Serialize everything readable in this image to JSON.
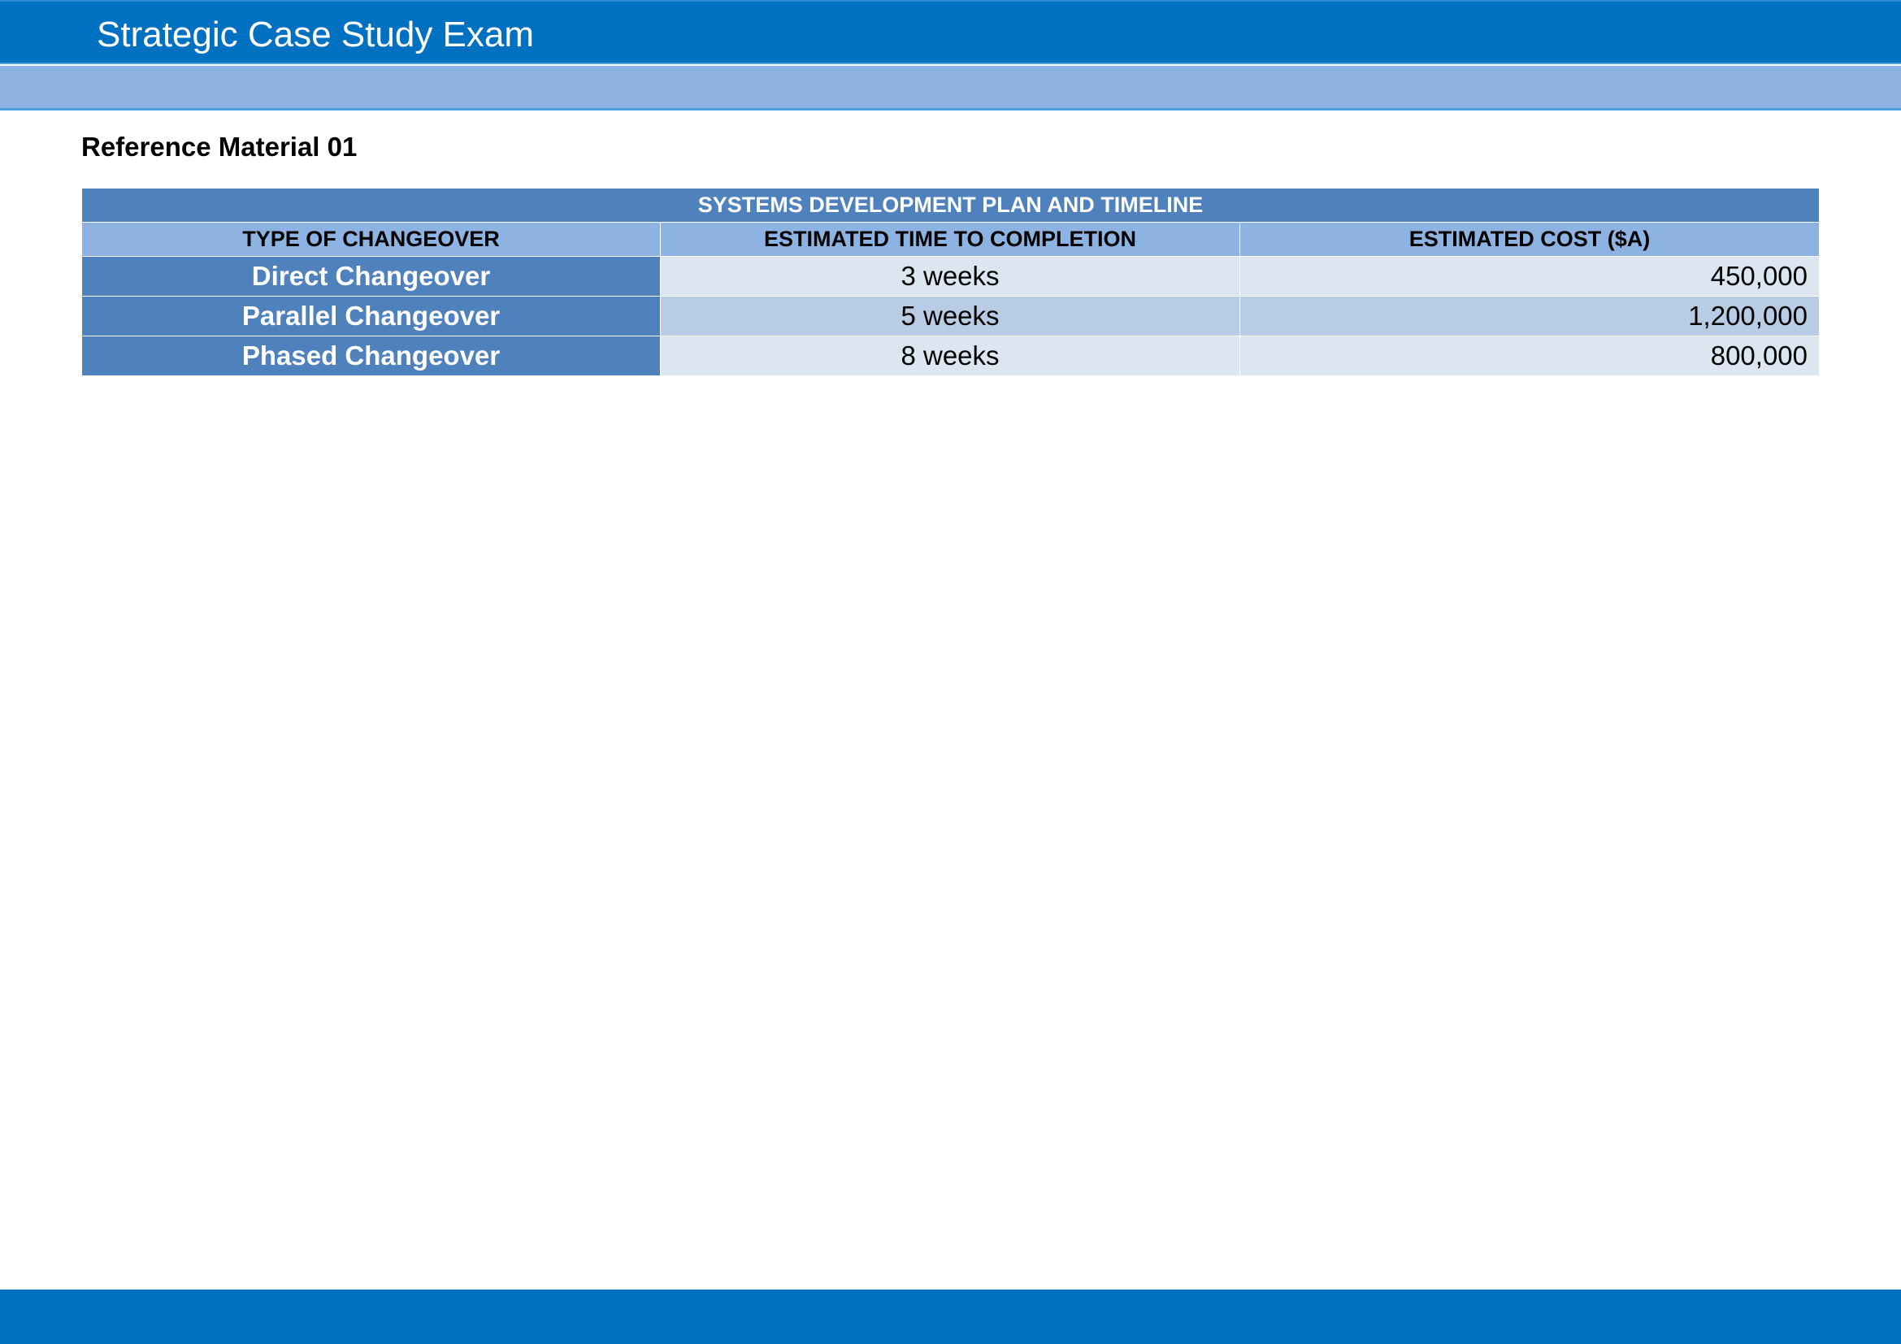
{
  "header": {
    "title": "Strategic Case Study Exam"
  },
  "reference": {
    "heading": "Reference Material 01"
  },
  "table": {
    "title": "SYSTEMS DEVELOPMENT PLAN AND TIMELINE",
    "columns": [
      "TYPE OF CHANGEOVER",
      "ESTIMATED TIME TO COMPLETION",
      "ESTIMATED COST ($A)"
    ],
    "rows": [
      {
        "type": "Direct Changeover",
        "time": "3 weeks",
        "cost": "450,000"
      },
      {
        "type": "Parallel Changeover",
        "time": "5 weeks",
        "cost": "1,200,000"
      },
      {
        "type": "Phased Changeover",
        "time": "8 weeks",
        "cost": "800,000"
      }
    ]
  },
  "colors": {
    "header_blue": "#0070C0",
    "sub_bar_blue": "#8DB3E2",
    "table_title_blue": "#4F81BD",
    "row_light": "#DCE6F1",
    "row_mid": "#B8CCE4"
  }
}
